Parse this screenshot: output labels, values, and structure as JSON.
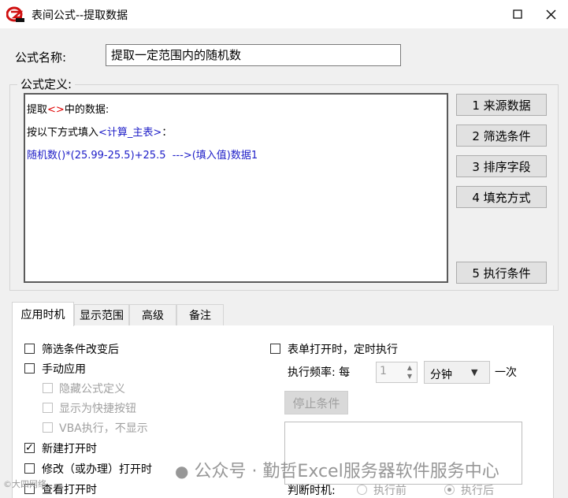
{
  "window": {
    "title": "表间公式--提取数据"
  },
  "formula_name": {
    "label": "公式名称:",
    "value": "提取一定范围内的随机数"
  },
  "definition": {
    "group_label": "公式定义:",
    "line1": {
      "before": "提取",
      "tag": "<>",
      "after": "中的数据:"
    },
    "line2": {
      "before": "按以下方式填入",
      "tag": "<计算_主表>",
      "after": "："
    },
    "line3": "随机数()*(25.99-25.5)+25.5  --->(填入值)数据1"
  },
  "side_buttons": [
    "1  来源数据",
    "2  筛选条件",
    "3  排序字段",
    "4 填充方式",
    "5 执行条件"
  ],
  "tabs": [
    "应用时机",
    "显示范围",
    "高级",
    "备注"
  ],
  "options": {
    "filter_change": {
      "label": "筛选条件改变后",
      "checked": false
    },
    "manual_apply": {
      "label": "手动应用",
      "checked": false
    },
    "hide_definition": {
      "label": "隐藏公式定义",
      "checked": false
    },
    "show_shortcut": {
      "label": "显示为快捷按钮",
      "checked": false
    },
    "vba_hidden": {
      "label": "VBA执行，不显示",
      "checked": false
    },
    "new_open": {
      "label": "新建打开时",
      "checked": true
    },
    "edit_open": {
      "label": "修改（或办理）打开时",
      "checked": false
    },
    "view_open": {
      "label": "查看打开时",
      "checked": false
    }
  },
  "timer": {
    "label": "表单打开时，定时执行",
    "checked": false,
    "freq_label": "执行频率: 每",
    "freq_value": "1",
    "unit": "分钟",
    "suffix": "一次",
    "stop_button": "停止条件",
    "judge_label": "判断时机:",
    "before": "执行前",
    "after": "执行后",
    "selected": "after"
  },
  "watermark": "公众号 · 勤哲Excel服务器软件服务中心",
  "watermark_corner": "©大四网络"
}
